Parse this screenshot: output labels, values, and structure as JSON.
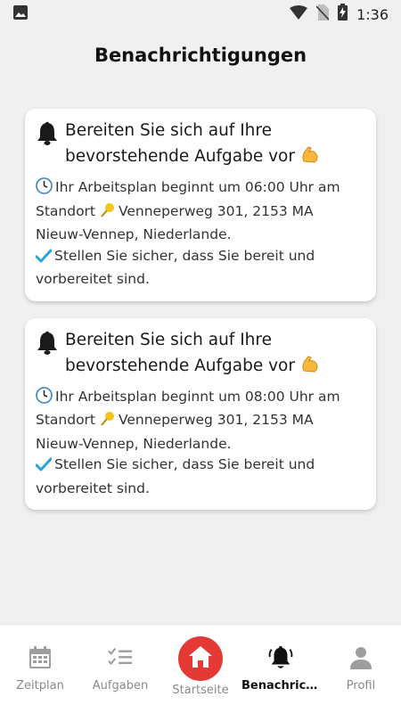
{
  "status_bar": {
    "time": "1:36",
    "icons": [
      "image-icon",
      "wifi-icon",
      "no-sim-icon",
      "battery-charging-icon"
    ]
  },
  "page": {
    "title": "Benachrichtigungen"
  },
  "notifications": [
    {
      "title": "Bereiten Sie sich auf Ihre bevorstehende Aufgabe vor",
      "schedule_text": "Ihr Arbeitsplan beginnt um 06:00 Uhr am Standort",
      "location_text": "Venneperweg 301, 2153 MA Nieuw-Vennep, Niederlande.",
      "ready_text": "Stellen Sie sicher, dass Sie bereit und vorbereitet sind."
    },
    {
      "title": "Bereiten Sie sich auf Ihre bevorstehende Aufgabe vor",
      "schedule_text": "Ihr Arbeitsplan beginnt um 08:00 Uhr am Standort",
      "location_text": "Venneperweg 301, 2153 MA Nieuw-Vennep, Niederlande.",
      "ready_text": "Stellen Sie sicher, dass Sie bereit und vorbereitet sind."
    }
  ],
  "bottom_nav": {
    "items": [
      {
        "label": "Zeitplan",
        "icon": "calendar-icon"
      },
      {
        "label": "Aufgaben",
        "icon": "checklist-icon"
      },
      {
        "label": "Startseite",
        "icon": "home-icon"
      },
      {
        "label": "Benachrichtigungen",
        "icon": "bell-icon"
      },
      {
        "label": "Profil",
        "icon": "person-icon"
      }
    ],
    "active_index": 3
  },
  "colors": {
    "accent_red": "#e53935",
    "background": "#f0f0f0",
    "card": "#ffffff",
    "check_blue": "#29a3db"
  }
}
